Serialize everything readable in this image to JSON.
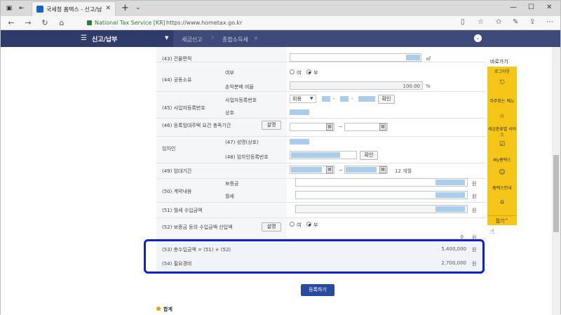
{
  "browser": {
    "tab_title": "국세청 홈택스 - 신고/납",
    "site_name": "National Tax Service [KR]",
    "url": "https://www.hometax.go.kr"
  },
  "header": {
    "menu_title": "신고/납부",
    "crumbs": [
      "세금신고",
      "종합소득세"
    ]
  },
  "form": {
    "r43": {
      "label": "(43) 건물면적",
      "unit": "㎡"
    },
    "r44": {
      "label": "(44) 공동소유",
      "sub1": "여부",
      "sub2": "손익분배 비율",
      "opt_yes": "여",
      "opt_no": "부",
      "ratio": "100.00",
      "ratio_unit": "%"
    },
    "r45": {
      "label": "(45) 사업자등록번호",
      "sub1": "사업자등록번호",
      "sub2": "상호",
      "select": "외용",
      "confirm": "확인"
    },
    "r46": {
      "label": "(46) 등록임대주택 요건 충족기간",
      "btn": "설명"
    },
    "tenant": {
      "label": "임차인",
      "sub1": "(47) 성명(상호)",
      "sub2": "(48) 임차인등록번호",
      "confirm": "확인"
    },
    "r49": {
      "label": "(49) 임대기간",
      "months": "12 개월"
    },
    "r50": {
      "label": "(50) 계약내용",
      "sub1": "보증금",
      "sub2": "월세",
      "unit": "원"
    },
    "r51": {
      "label": "(51) 월세 수입금액",
      "unit": "원"
    },
    "r52": {
      "label": "(52) 보증금 등의 수입금액 산입액",
      "btn": "설명",
      "opt_yes": "여",
      "opt_no": "부",
      "zero": "0",
      "unit": "원"
    },
    "r53": {
      "label": "(53) 총수입금액 = (51) + (52)",
      "value": "5,400,000",
      "unit": "원"
    },
    "r54": {
      "label": "(54) 필요경비",
      "value": "2,700,000",
      "unit": "원"
    },
    "submit": "등록하기",
    "summary_title": "합계"
  },
  "quick": {
    "title": "바로가기",
    "items": [
      "로그아웃",
      "자주찾는 메뉴",
      "세금종류별 서비스",
      "My홈택스",
      "홈택스안내"
    ],
    "fold": "접기^"
  }
}
